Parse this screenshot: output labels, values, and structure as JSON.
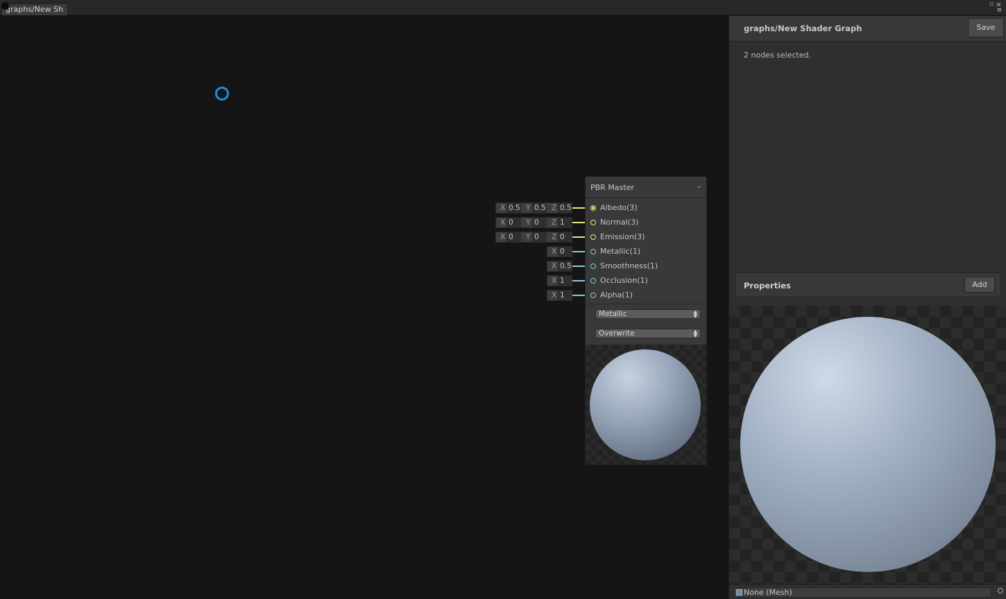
{
  "tab": {
    "label": "graphs/New Sh"
  },
  "node": {
    "title": "PBR Master",
    "ports": [
      {
        "label": "Albedo(3)",
        "color": "#e9e87e",
        "fields": [
          [
            "X",
            "0.5"
          ],
          [
            "Y",
            "0.5"
          ],
          [
            "Z",
            "0.5"
          ]
        ]
      },
      {
        "label": "Normal(3)",
        "color": "#e9e87e",
        "fields": [
          [
            "X",
            "0"
          ],
          [
            "Y",
            "0"
          ],
          [
            "Z",
            "1"
          ]
        ]
      },
      {
        "label": "Emission(3)",
        "color": "#e9e87e",
        "fields": [
          [
            "X",
            "0"
          ],
          [
            "Y",
            "0"
          ],
          [
            "Z",
            "0"
          ]
        ]
      },
      {
        "label": "Metallic(1)",
        "color": "#83d0e0",
        "fields": [
          [
            "X",
            "0"
          ]
        ]
      },
      {
        "label": "Smoothness(1)",
        "color": "#83d0e0",
        "fields": [
          [
            "X",
            "0.5"
          ]
        ]
      },
      {
        "label": "Occlusion(1)",
        "color": "#83d0e0",
        "fields": [
          [
            "X",
            "1"
          ]
        ]
      },
      {
        "label": "Alpha(1)",
        "color": "#83d0e0",
        "fields": [
          [
            "X",
            "1"
          ]
        ]
      }
    ],
    "workflow": "Metallic",
    "blend_mode": "Overwrite"
  },
  "inspector": {
    "title": "graphs/New Shader Graph",
    "save_label": "Save",
    "selection_text": "2 nodes selected.",
    "properties_label": "Properties",
    "add_label": "Add",
    "preview_mesh": "None (Mesh)"
  },
  "colors": {
    "accent_cursor": "#1e8ddf",
    "vector3_port": "#e9e87e",
    "vector1_port": "#83d0e0"
  }
}
